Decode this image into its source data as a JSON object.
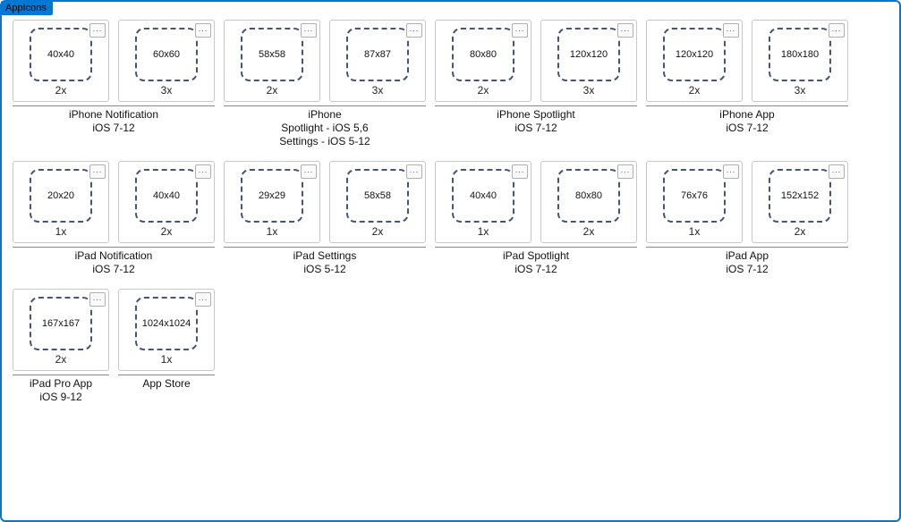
{
  "window": {
    "title": "AppIcons",
    "menu_glyph": "..."
  },
  "groups": [
    {
      "label": "iPhone Notification\niOS 7-12",
      "slots": [
        {
          "size": "40x40",
          "scale": "2x"
        },
        {
          "size": "60x60",
          "scale": "3x"
        }
      ]
    },
    {
      "label": "iPhone\nSpotlight - iOS 5,6\nSettings - iOS 5-12",
      "slots": [
        {
          "size": "58x58",
          "scale": "2x"
        },
        {
          "size": "87x87",
          "scale": "3x"
        }
      ]
    },
    {
      "label": "iPhone Spotlight\niOS 7-12",
      "slots": [
        {
          "size": "80x80",
          "scale": "2x"
        },
        {
          "size": "120x120",
          "scale": "3x"
        }
      ]
    },
    {
      "label": "iPhone App\niOS 7-12",
      "slots": [
        {
          "size": "120x120",
          "scale": "2x"
        },
        {
          "size": "180x180",
          "scale": "3x"
        }
      ]
    },
    {
      "label": "iPad Notification\niOS 7-12",
      "slots": [
        {
          "size": "20x20",
          "scale": "1x"
        },
        {
          "size": "40x40",
          "scale": "2x"
        }
      ]
    },
    {
      "label": "iPad Settings\niOS 5-12",
      "slots": [
        {
          "size": "29x29",
          "scale": "1x"
        },
        {
          "size": "58x58",
          "scale": "2x"
        }
      ]
    },
    {
      "label": "iPad Spotlight\niOS 7-12",
      "slots": [
        {
          "size": "40x40",
          "scale": "1x"
        },
        {
          "size": "80x80",
          "scale": "2x"
        }
      ]
    },
    {
      "label": "iPad App\niOS 7-12",
      "slots": [
        {
          "size": "76x76",
          "scale": "1x"
        },
        {
          "size": "152x152",
          "scale": "2x"
        }
      ]
    },
    {
      "label": "iPad Pro App\niOS 9-12",
      "slots": [
        {
          "size": "167x167",
          "scale": "2x"
        }
      ]
    },
    {
      "label": "App Store",
      "slots": [
        {
          "size": "1024x1024",
          "scale": "1x"
        }
      ]
    }
  ]
}
